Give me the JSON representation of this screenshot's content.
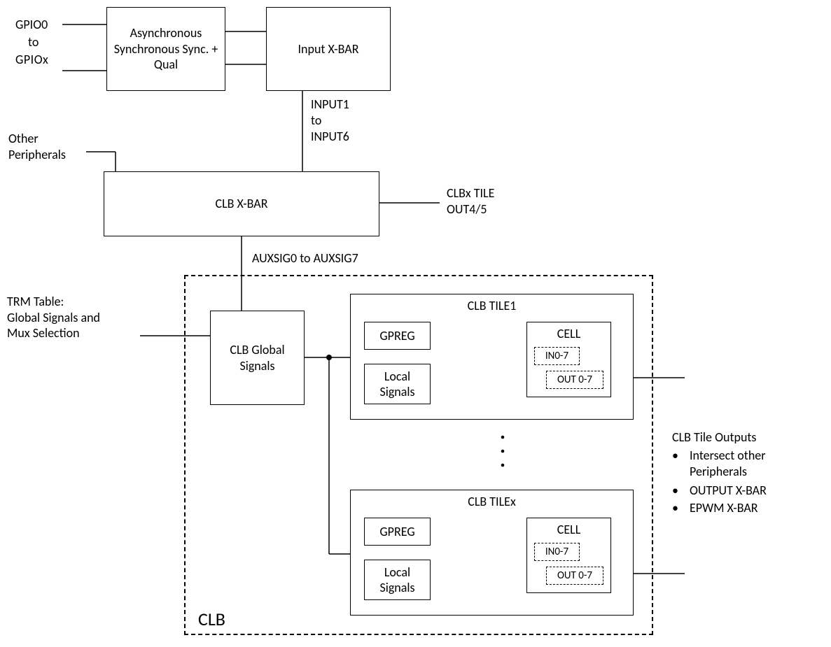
{
  "labels": {
    "gpio0": "GPIO0",
    "to1": "to",
    "gpiox": "GPIOx",
    "other_peripherals": "Other\nPeripherals",
    "input1": "INPUT1",
    "to2": "to",
    "input6": "INPUT6",
    "clbx_tile": "CLBx TILE\nOUT4/5",
    "auxsig": "AUXSIG0 to AUXSIG7",
    "trm_table": "TRM Table:\nGlobal Signals and\nMux Selection",
    "clb_label": "CLB",
    "outputs_title": "CLB Tile Outputs",
    "output_b1": "Intersect other\nPeripherals",
    "output_b2": "OUTPUT X-BAR",
    "output_b3": "EPWM X-BAR"
  },
  "boxes": {
    "async_sync": "Asynchronous\nSynchronous\nSync. + Qual",
    "input_xbar": "Input X-BAR",
    "clb_xbar": "CLB X-BAR",
    "clb_global": "CLB Global\nSignals",
    "gpreg": "GPREG",
    "local_signals": "Local\nSignals",
    "cell": "CELL",
    "in07": "IN0-7",
    "out07": "OUT 0-7",
    "tile1_title": "CLB TILE1",
    "tilex_title": "CLB TILEx"
  }
}
